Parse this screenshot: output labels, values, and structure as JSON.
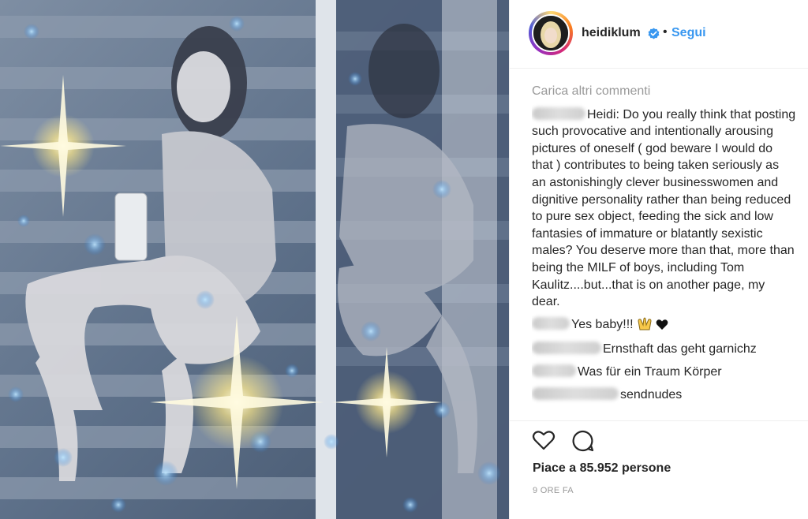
{
  "post": {
    "username": "heidiklum",
    "separator": "•",
    "follow_label": "Segui",
    "verified_icon": "verified-badge-icon",
    "accent_color": "#3897f0"
  },
  "comments": {
    "load_more": "Carica altri commenti",
    "items": [
      {
        "text": "Heidi: Do you really think that posting such provocative and intentionally arousing pictures of oneself ( god beware I would do that ) contributes to being taken seriously as an astonishingly clever businesswomen and dignitive personality rather than being reduced to pure sex object, feeding the sick and low fantasies of immature or blatantly sexistic males? You deserve more than that, more than being the MILF of boys, including Tom Kaulitz....but...that is on another page, my dear."
      },
      {
        "text": "Yes baby!!!"
      },
      {
        "text": "Ernsthaft das geht garnichz"
      },
      {
        "text": "Was für ein Traum Körper"
      },
      {
        "text": "sendnudes"
      }
    ]
  },
  "actions": {
    "like_icon": "heart-icon",
    "comment_icon": "comment-icon",
    "likes_text": "Piace a 85.952 persone",
    "timestamp": "9 ORE FA"
  },
  "photo": {
    "subject": "mirror-photo",
    "sparkle_icon": "sparkle-icon"
  }
}
